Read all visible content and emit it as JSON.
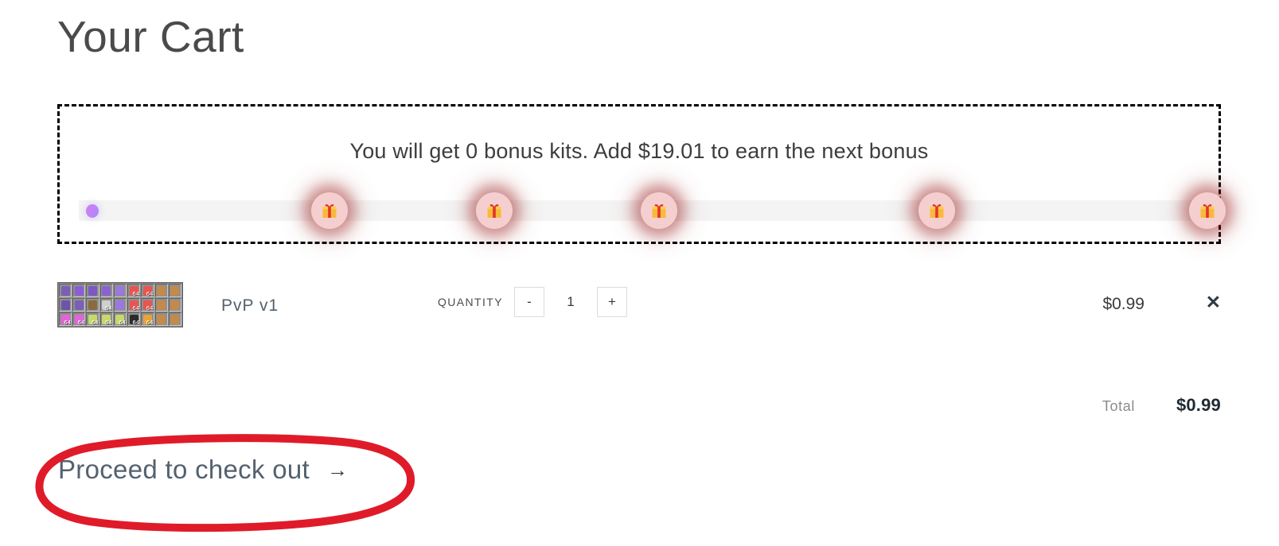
{
  "page": {
    "title": "Your Cart"
  },
  "bonus_banner": {
    "message": "You will get 0 bonus kits. Add $19.01 to earn the next bonus",
    "progress": {
      "knob_icon": "progress-knob",
      "knob_position_percent": 0,
      "track_color": "#f4f4f4",
      "knob_gradient_from": "#d77bef",
      "knob_gradient_to": "#a78bfa",
      "milestone_icon": "gift-icon",
      "milestone_circle_color": "#f5cfcf",
      "milestone_glow_color": "#961414",
      "milestones": [
        {
          "position_percent": 22.2
        },
        {
          "position_percent": 36.8
        },
        {
          "position_percent": 51.4
        },
        {
          "position_percent": 76.0
        },
        {
          "position_percent": 100.0
        }
      ]
    }
  },
  "cart": {
    "items": [
      {
        "thumbnail_alt": "minecraft-kit-inventory",
        "name": "PvP v1",
        "quantity_label": "QUANTITY",
        "decrement_label": "-",
        "quantity_value": "1",
        "increment_label": "+",
        "price": "$0.99",
        "remove_label": "✕"
      }
    ],
    "total_label": "Total",
    "total_value": "$0.99"
  },
  "checkout": {
    "label": "Proceed to check out",
    "arrow": "→"
  },
  "annotation": {
    "shape": "hand-drawn-ellipse",
    "color": "#e01b29",
    "stroke_width": 10,
    "targets": "checkout-link"
  },
  "inventory_grid": {
    "rows": [
      [
        {
          "color": "#7a5fb5",
          "count": ""
        },
        {
          "color": "#8a5ed4",
          "count": ""
        },
        {
          "color": "#7d57c4",
          "count": ""
        },
        {
          "color": "#8a63d0",
          "count": ""
        },
        {
          "color": "#9a78dd",
          "count": ""
        },
        {
          "color": "#e8554f",
          "count": "64"
        },
        {
          "color": "#e8554f",
          "count": "64"
        },
        {
          "color": "#c38a4a",
          "count": ""
        },
        {
          "color": "#c38a4a",
          "count": ""
        }
      ],
      [
        {
          "color": "#6e54a8",
          "count": ""
        },
        {
          "color": "#7a5fb5",
          "count": ""
        },
        {
          "color": "#8a6a40",
          "count": ""
        },
        {
          "color": "#cfcfcf",
          "count": "64"
        },
        {
          "color": "#9a78dd",
          "count": ""
        },
        {
          "color": "#e8554f",
          "count": "64"
        },
        {
          "color": "#e8554f",
          "count": "64"
        },
        {
          "color": "#c38a4a",
          "count": ""
        },
        {
          "color": "#c38a4a",
          "count": ""
        }
      ],
      [
        {
          "color": "#e464d8",
          "count": "64"
        },
        {
          "color": "#e464d8",
          "count": "64"
        },
        {
          "color": "#c8d86a",
          "count": "64"
        },
        {
          "color": "#c8d86a",
          "count": "64"
        },
        {
          "color": "#c8d86a",
          "count": "64"
        },
        {
          "color": "#2b2b2b",
          "count": "64"
        },
        {
          "color": "#e8a33a",
          "count": "64"
        },
        {
          "color": "#c38a4a",
          "count": ""
        },
        {
          "color": "#c38a4a",
          "count": ""
        }
      ]
    ]
  }
}
